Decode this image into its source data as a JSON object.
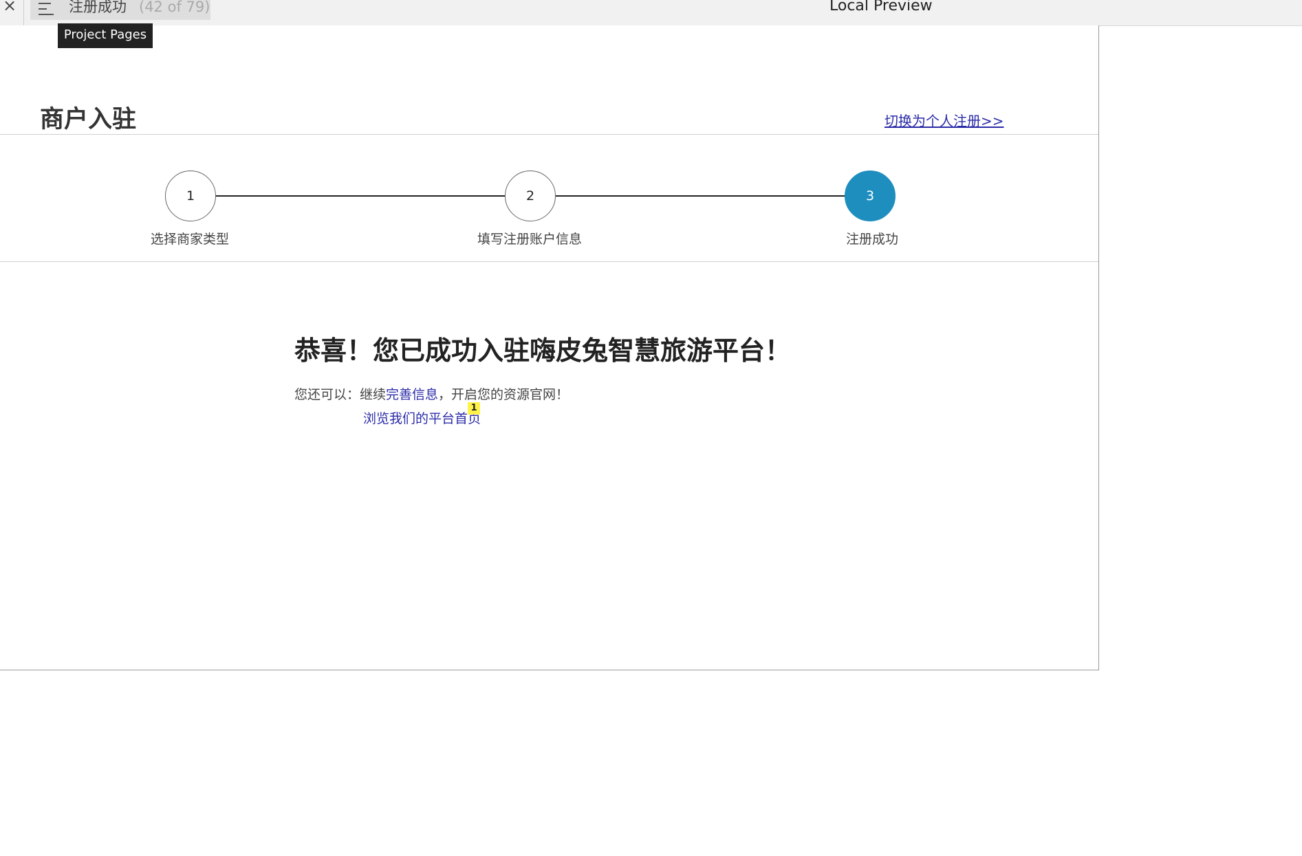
{
  "topbar": {
    "close_glyph": "×",
    "menu_icon": "hamburger-icon",
    "page_name": "注册成功",
    "page_count": "(42 of 79)",
    "title": "Local Preview",
    "tooltip": "Project Pages"
  },
  "header": {
    "title": "商户入驻",
    "switch_link": "切换为个人注册>>"
  },
  "steps": [
    {
      "number": "1",
      "label": "选择商家类型",
      "active": false
    },
    {
      "number": "2",
      "label": "填写注册账户信息",
      "active": false
    },
    {
      "number": "3",
      "label": "注册成功",
      "active": true
    }
  ],
  "colors": {
    "active_step": "#1e8ebf",
    "link": "#2b2ba8",
    "badge": "#fff34a"
  },
  "success": {
    "title": "恭喜！您已成功入驻嗨皮兔智慧旅游平台！",
    "prefix": "您还可以：继续",
    "complete_info_link": "完善信息",
    "suffix": "，开启您的资源官网！",
    "home_link": "浏览我们的平台首页",
    "badge": "1"
  }
}
